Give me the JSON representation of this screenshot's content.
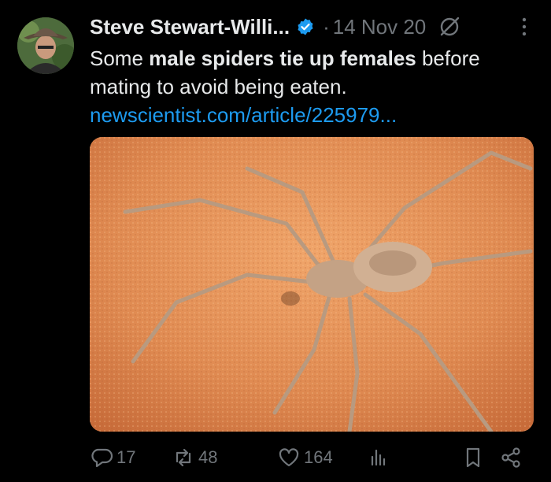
{
  "author": {
    "name": "Steve Stewart-Willi...",
    "date": "14 Nov 20",
    "separator": "·"
  },
  "tweet": {
    "text_prefix": "Some ",
    "text_bold": "male spiders tie up females",
    "text_suffix": " before mating to avoid being eaten.",
    "link": "newscientist.com/article/225979..."
  },
  "actions": {
    "replies": "17",
    "reposts": "48",
    "likes": "164"
  },
  "colors": {
    "accent": "#1d9bf0",
    "muted": "#71767b",
    "text": "#e7e9ea",
    "background": "#000000"
  },
  "icons": [
    "verified-badge-icon",
    "grok-icon",
    "more-icon",
    "reply-icon",
    "repost-icon",
    "like-icon",
    "views-icon",
    "bookmark-icon",
    "share-icon"
  ]
}
